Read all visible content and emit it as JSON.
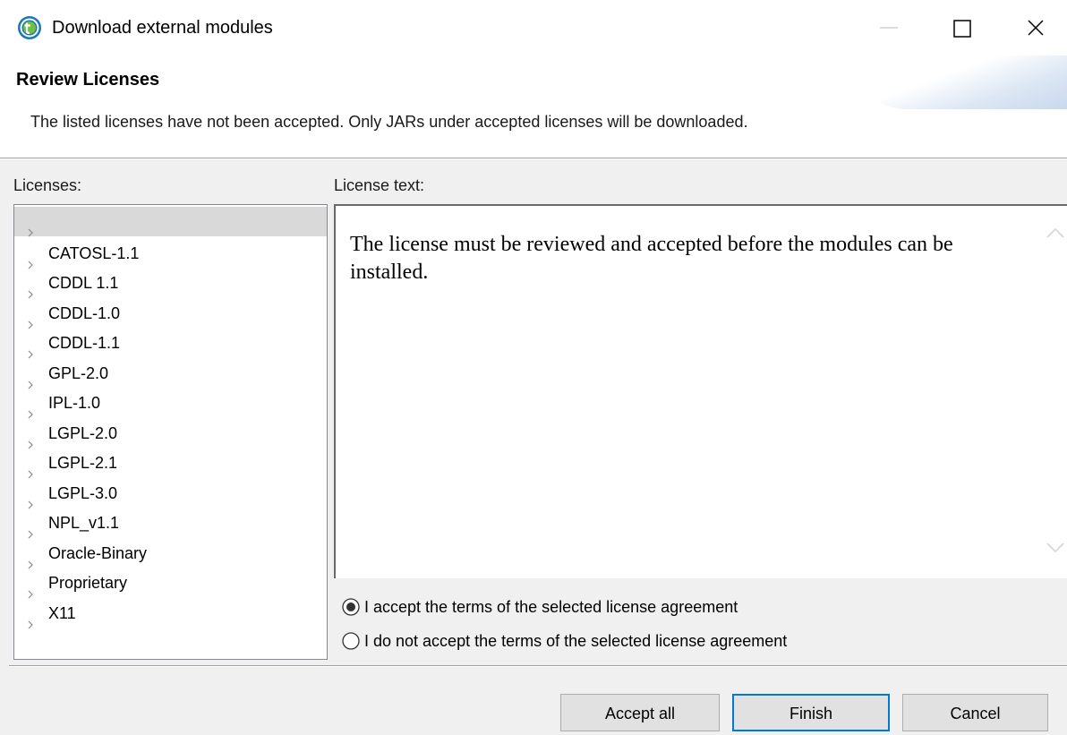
{
  "window": {
    "title": "Download external modules",
    "icon": "talend-app-icon",
    "controls": [
      "minimize-icon",
      "maximize-icon",
      "close-icon"
    ]
  },
  "header": {
    "title": "Review Licenses",
    "message": "The listed licenses have not been accepted. Only JARs under accepted licenses will be downloaded."
  },
  "licenses": {
    "label": "Licenses:",
    "items": [
      {
        "label": "",
        "selected": true
      },
      {
        "label": "CATOSL-1.1"
      },
      {
        "label": "CDDL 1.1"
      },
      {
        "label": "CDDL-1.0"
      },
      {
        "label": "CDDL-1.1"
      },
      {
        "label": "GPL-2.0"
      },
      {
        "label": "IPL-1.0"
      },
      {
        "label": "LGPL-2.0"
      },
      {
        "label": "LGPL-2.1"
      },
      {
        "label": "LGPL-3.0"
      },
      {
        "label": "NPL_v1.1"
      },
      {
        "label": "Oracle-Binary"
      },
      {
        "label": "Proprietary"
      },
      {
        "label": "X11"
      }
    ]
  },
  "license_text": {
    "label": "License text:",
    "body": "The license must be reviewed and accepted before the modules can be installed."
  },
  "agreement": {
    "accept_label": "I accept the terms of the selected license agreement",
    "decline_label": "I do not accept the terms of the selected license agreement",
    "selected": "accept"
  },
  "buttons": {
    "accept_all": "Accept all",
    "finish": "Finish",
    "cancel": "Cancel"
  },
  "colors": {
    "app_icon": "#1a76b8",
    "default_button_border": "#0078d7",
    "selected_row": "#d9d9d9"
  }
}
